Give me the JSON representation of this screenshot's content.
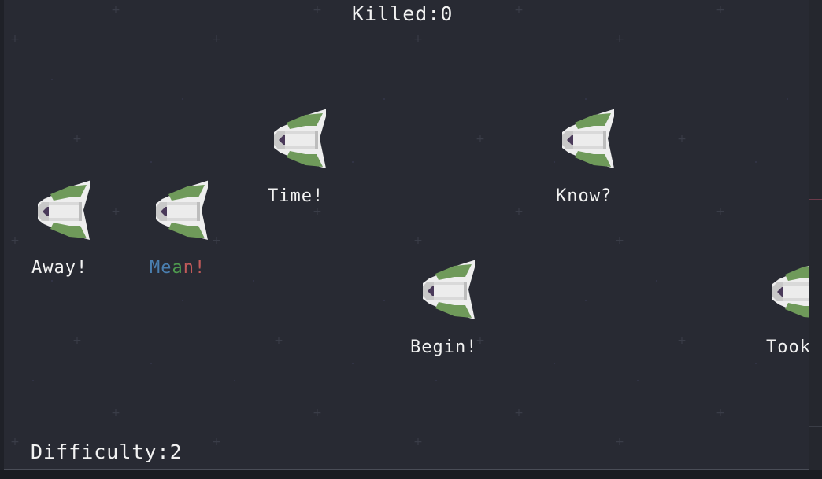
{
  "hud": {
    "killed_label": "Killed:",
    "killed_value": "0",
    "difficulty_label": "Difficulty:",
    "difficulty_value": "2"
  },
  "enemies": [
    {
      "word": "Time!"
    },
    {
      "word": "Know?"
    },
    {
      "word": "Away!"
    },
    {
      "word_typed": "Me",
      "word_next": "a",
      "word_rest": "n!"
    },
    {
      "word": "Begin!"
    },
    {
      "word": "Took"
    }
  ],
  "colors": {
    "background": "#282a33",
    "text": "#f2f2f2",
    "typed": "#4a7fb0",
    "next_char": "#4e9a4e",
    "remaining": "#c25a5a",
    "ship_green": "#6f9a5a",
    "ship_white": "#e8e8e8",
    "ship_core": "#4a3a5a"
  },
  "icons": [
    "enemy-ship-icon",
    "star-icon"
  ]
}
